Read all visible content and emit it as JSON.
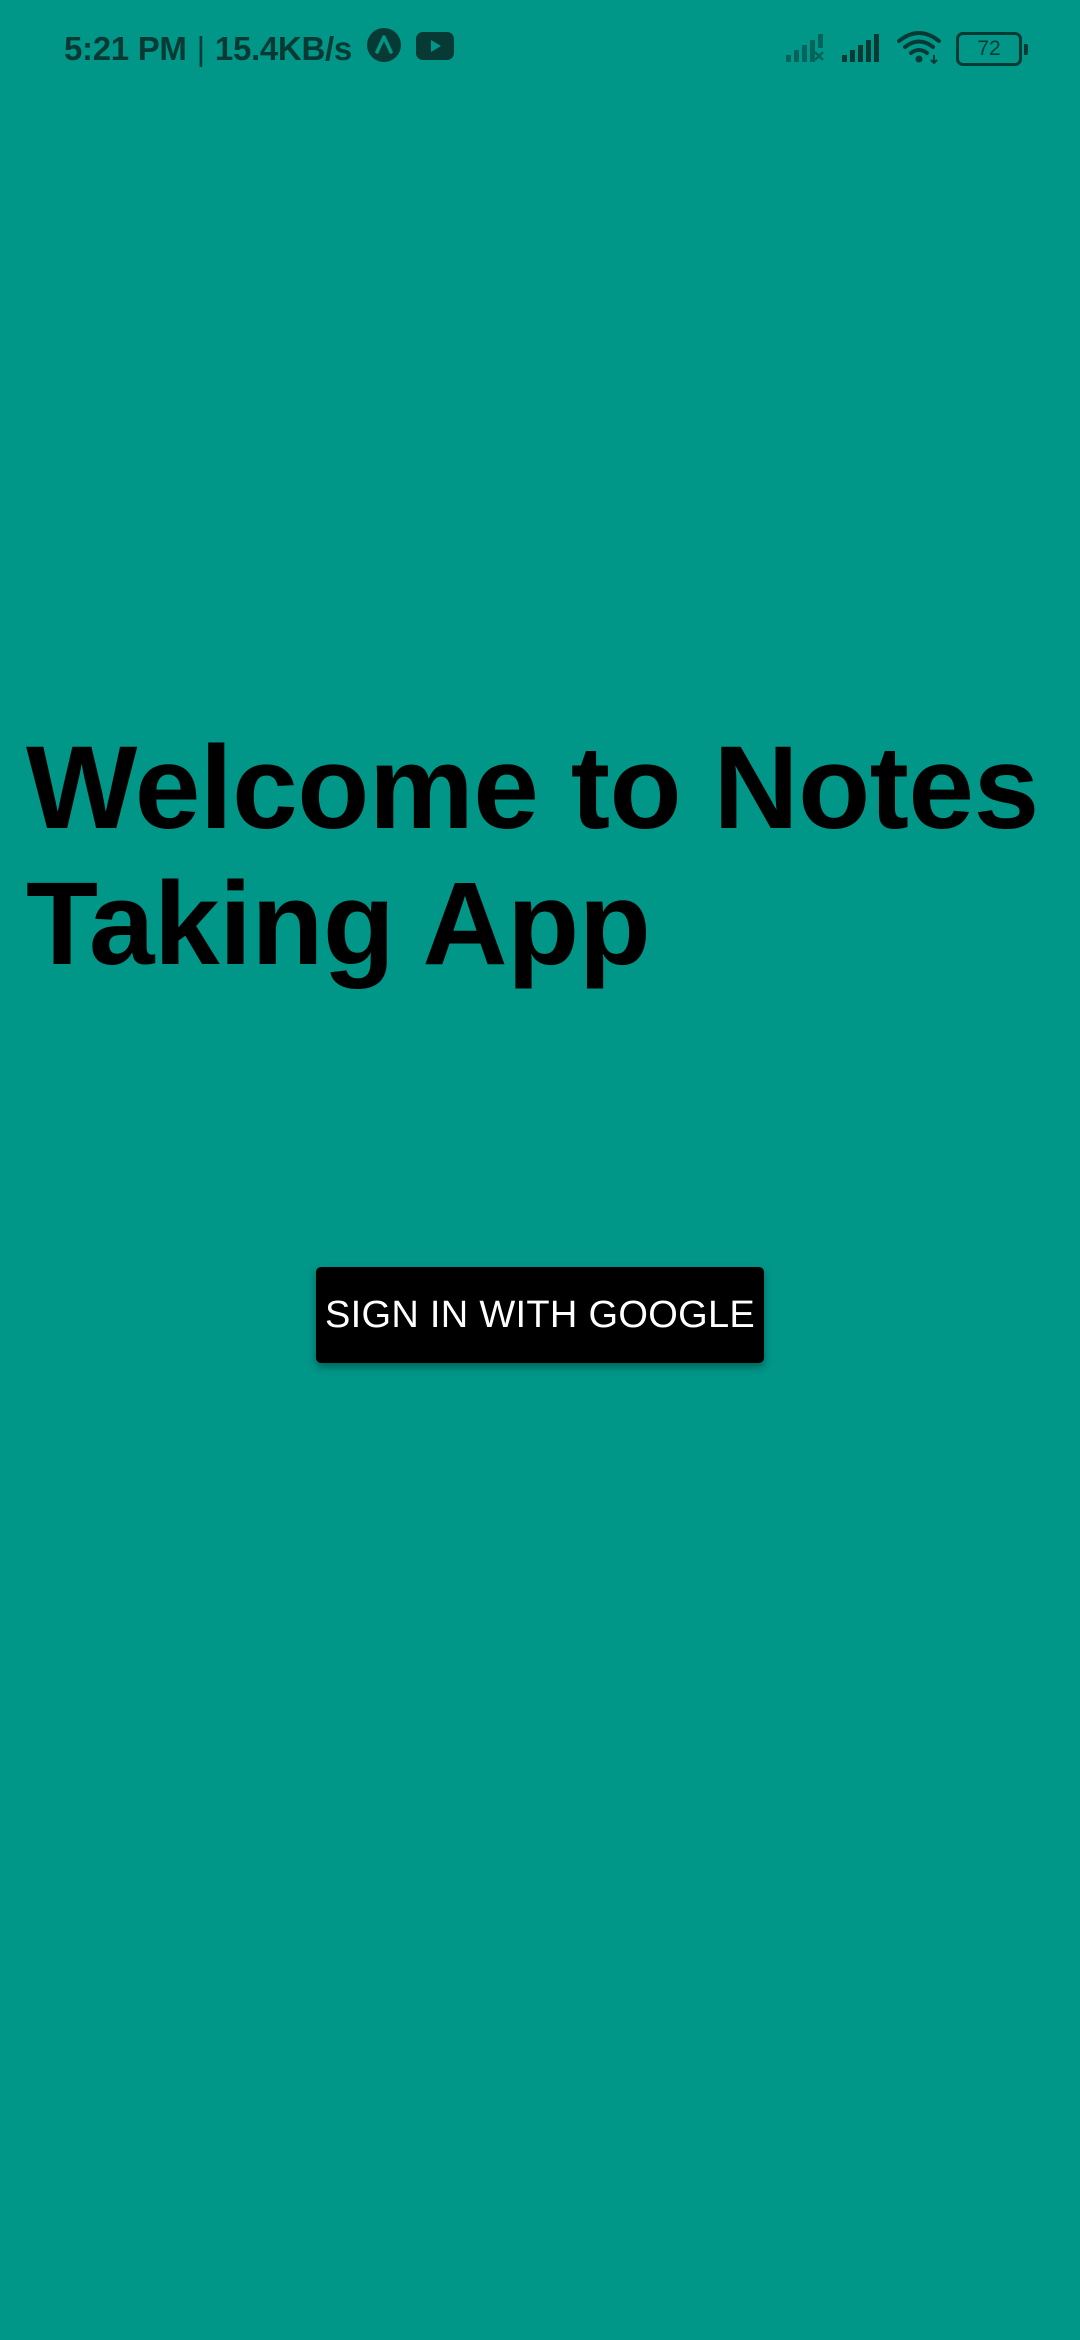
{
  "status_bar": {
    "time": "5:21 PM",
    "separator": "|",
    "network_speed": "15.4KB/s",
    "notification_icons": [
      "arrow-up-circle-icon",
      "youtube-icon"
    ],
    "system_icons": [
      "signal-no-service-icon",
      "signal-strength-icon",
      "wifi-icon",
      "battery-icon"
    ],
    "battery_level": "72"
  },
  "main": {
    "title": "Welcome to Notes Taking App",
    "sign_in_label": "SIGN IN WITH GOOGLE"
  },
  "colors": {
    "background": "#009688",
    "button_background": "#000000",
    "button_text": "#ffffff",
    "title_text": "#000000",
    "status_text": "#083a35"
  }
}
